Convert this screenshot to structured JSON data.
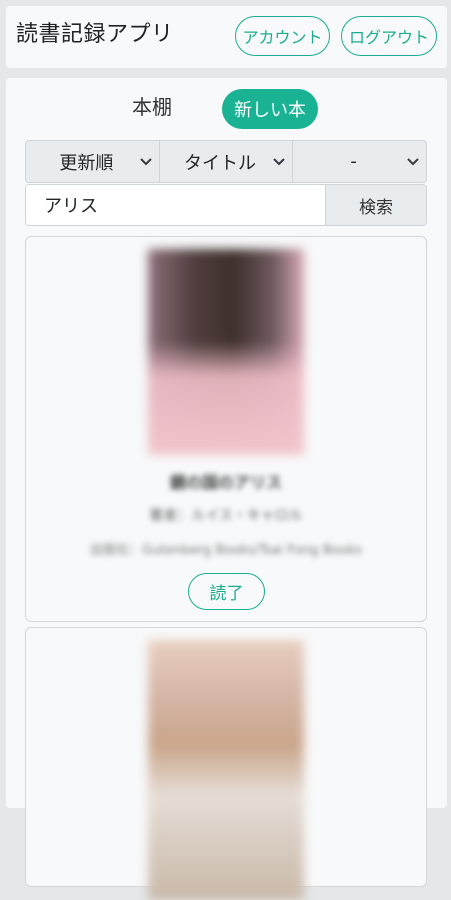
{
  "header": {
    "app_title": "読書記録アプリ",
    "account_label": "アカウント",
    "logout_label": "ログアウト"
  },
  "tabs": {
    "bookshelf_label": "本棚",
    "new_book_label": "新しい本"
  },
  "filters": {
    "sort_value": "更新順",
    "field_value": "タイトル",
    "status_value": "-"
  },
  "search": {
    "value": "アリス",
    "button_label": "検索"
  },
  "books": [
    {
      "title": "鏡の国のアリス",
      "author": "著者：ルイス・キャロル",
      "publisher": "出版社：Gutenberg Books/Tsai Fong Books",
      "status_label": "読了"
    }
  ],
  "colors": {
    "accent": "#1aae8e",
    "accent_fill": "#19b393",
    "page_bg": "#e5e7e9",
    "panel_bg": "#f8f9fa"
  }
}
